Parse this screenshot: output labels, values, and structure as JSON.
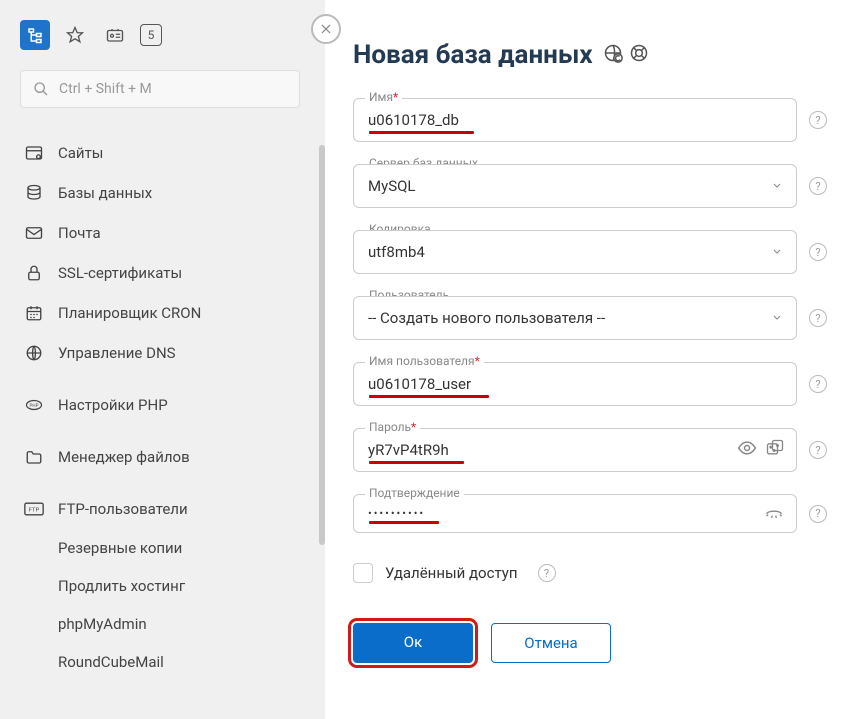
{
  "search": {
    "placeholder": "Ctrl + Shift + M"
  },
  "topbar": {
    "counter": "5"
  },
  "sidebar": {
    "items": [
      {
        "label": "Сайты"
      },
      {
        "label": "Базы данных"
      },
      {
        "label": "Почта"
      },
      {
        "label": "SSL-сертификаты"
      },
      {
        "label": "Планировщик CRON"
      },
      {
        "label": "Управление DNS"
      },
      {
        "label": "Настройки PHP"
      },
      {
        "label": "Менеджер файлов"
      },
      {
        "label": "FTP-пользователи"
      },
      {
        "label": "Резервные копии"
      },
      {
        "label": "Продлить хостинг"
      },
      {
        "label": "phpMyAdmin"
      },
      {
        "label": "RoundCubeMail"
      }
    ]
  },
  "main": {
    "title": "Новая база данных",
    "fields": {
      "name": {
        "label": "Имя",
        "value": "u0610178_db"
      },
      "server": {
        "label": "Сервер баз данных",
        "value": "MySQL"
      },
      "encoding": {
        "label": "Кодировка",
        "value": "utf8mb4"
      },
      "user": {
        "label": "Пользователь",
        "value": "-- Создать нового пользователя --"
      },
      "username": {
        "label": "Имя пользователя",
        "value": "u0610178_user"
      },
      "password": {
        "label": "Пароль",
        "value": "yR7vP4tR9h"
      },
      "confirm": {
        "label": "Подтверждение",
        "value": "••••••••••"
      }
    },
    "remote_access": "Удалённый доступ",
    "ok": "Ок",
    "cancel": "Отмена"
  }
}
